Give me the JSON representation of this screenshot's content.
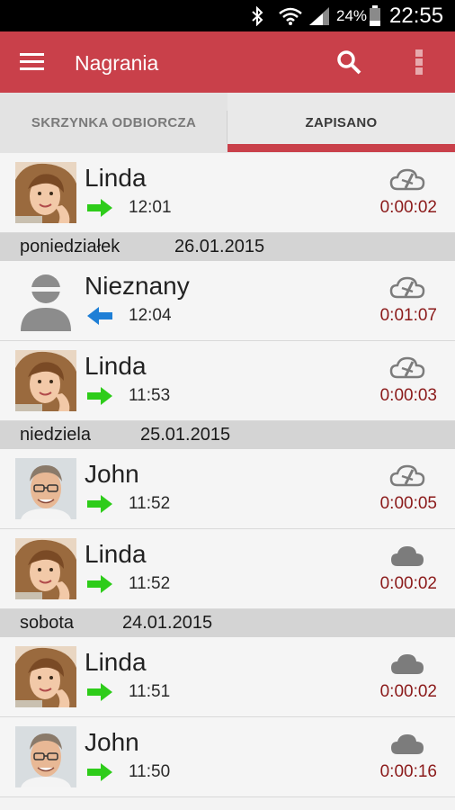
{
  "status_bar": {
    "battery_percent": "24%",
    "time": "22:55",
    "icons": [
      "bluetooth-icon",
      "wifi-icon",
      "signal-icon",
      "battery-icon"
    ]
  },
  "app_bar": {
    "title": "Nagrania",
    "icons": [
      "menu-icon",
      "search-icon",
      "more-icon"
    ],
    "color": "#c9404a"
  },
  "tabs": [
    {
      "label": "SKRZYNKA ODBIORCZA",
      "selected": false
    },
    {
      "label": "ZAPISANO",
      "selected": true
    }
  ],
  "list": [
    {
      "type": "call",
      "name": "Linda",
      "avatar": "linda-photo",
      "direction": "outgoing",
      "time": "12:01",
      "cloud": "cloud-crossed-icon",
      "duration": "0:00:02"
    },
    {
      "type": "header",
      "day": "poniedziałek",
      "date": "26.01.2015"
    },
    {
      "type": "call",
      "name": "Nieznany",
      "avatar": "unknown-person",
      "direction": "incoming",
      "time": "12:04",
      "cloud": "cloud-crossed-icon",
      "duration": "0:01:07"
    },
    {
      "type": "call",
      "name": "Linda",
      "avatar": "linda-photo",
      "direction": "outgoing",
      "time": "11:53",
      "cloud": "cloud-crossed-icon",
      "duration": "0:00:03"
    },
    {
      "type": "header",
      "day": "niedziela",
      "date": "25.01.2015"
    },
    {
      "type": "call",
      "name": "John",
      "avatar": "john-photo",
      "direction": "outgoing",
      "time": "11:52",
      "cloud": "cloud-crossed-icon",
      "duration": "0:00:05"
    },
    {
      "type": "call",
      "name": "Linda",
      "avatar": "linda-photo",
      "direction": "outgoing",
      "time": "11:52",
      "cloud": "cloud-icon",
      "duration": "0:00:02"
    },
    {
      "type": "header",
      "day": "sobota",
      "date": "24.01.2015"
    },
    {
      "type": "call",
      "name": "Linda",
      "avatar": "linda-photo",
      "direction": "outgoing",
      "time": "11:51",
      "cloud": "cloud-icon",
      "duration": "0:00:02"
    },
    {
      "type": "call",
      "name": "John",
      "avatar": "john-photo",
      "direction": "outgoing",
      "time": "11:50",
      "cloud": "cloud-icon",
      "duration": "0:00:16"
    }
  ],
  "colors": {
    "accent": "#c9404a",
    "duration_text": "#8b1a1a",
    "outgoing_arrow": "#2ecc1a",
    "incoming_arrow": "#1e7fd6"
  }
}
